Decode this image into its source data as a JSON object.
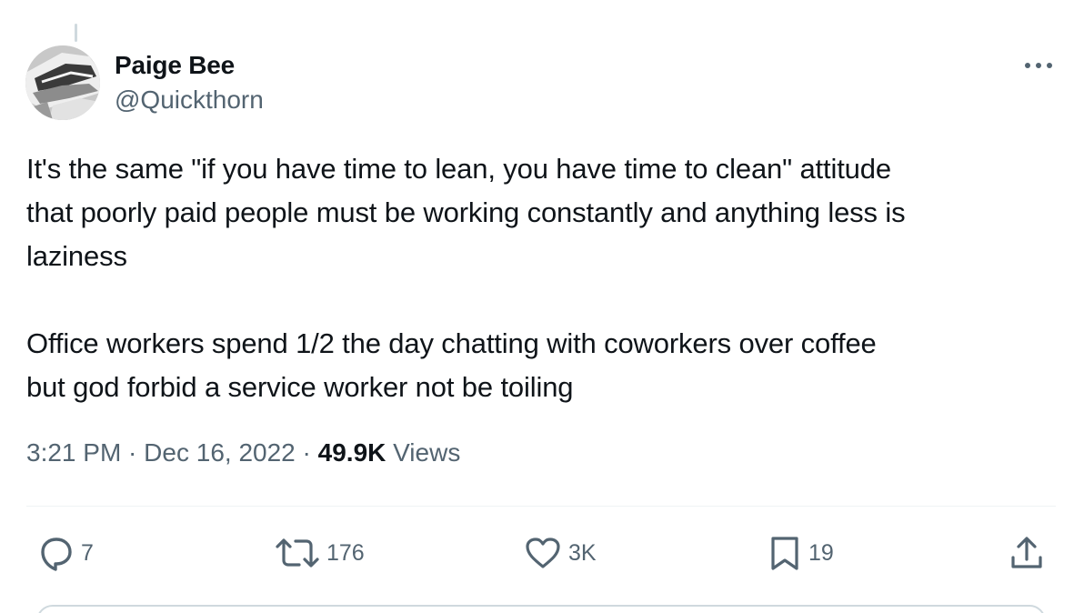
{
  "author": {
    "name": "Paige Bee",
    "handle": "@Quickthorn"
  },
  "tweet": {
    "paragraphs": [
      "It's the same \"if you have time to lean, you have time to clean\" attitude\nthat poorly paid people must be working constantly and anything less is\nlaziness",
      "Office workers spend 1/2 the day chatting with coworkers over coffee\nbut god forbid a service worker not be toiling"
    ],
    "time": "3:21 PM",
    "date": "Dec 16, 2022",
    "views_count": "49.9K",
    "views_label": "Views"
  },
  "actions": {
    "replies": "7",
    "reposts": "176",
    "likes": "3K",
    "bookmarks": "19"
  },
  "icons": {
    "more": "more-horizontal-icon",
    "reply": "reply-icon",
    "repost": "repost-icon",
    "like": "heart-icon",
    "bookmark": "bookmark-icon",
    "share": "share-icon"
  },
  "colors": {
    "text": "#0f1419",
    "secondary": "#536471",
    "divider": "#eff3f4"
  }
}
